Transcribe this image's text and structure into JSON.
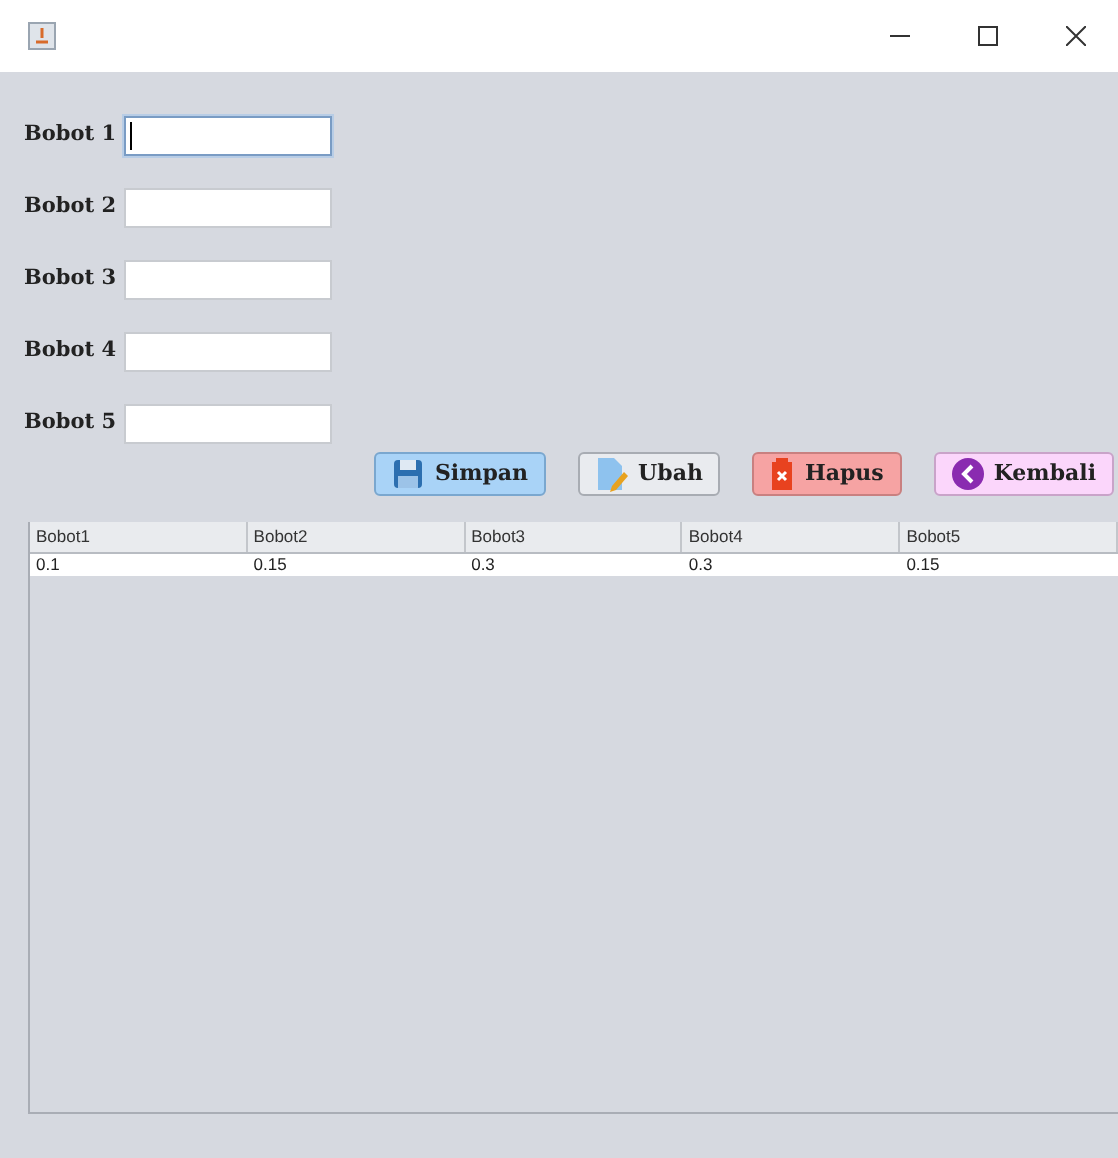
{
  "fields": [
    {
      "label": "Bobot 1",
      "focused": true
    },
    {
      "label": "Bobot 2",
      "focused": false
    },
    {
      "label": "Bobot 3",
      "focused": false
    },
    {
      "label": "Bobot 4",
      "focused": false
    },
    {
      "label": "Bobot 5",
      "focused": false
    }
  ],
  "buttons": [
    {
      "label": "Simpan",
      "kind": "save"
    },
    {
      "label": "Ubah",
      "kind": "edit"
    },
    {
      "label": "Hapus",
      "kind": "delete"
    },
    {
      "label": "Kembali",
      "kind": "back"
    }
  ],
  "table": {
    "columns": [
      "Bobot1",
      "Bobot2",
      "Bobot3",
      "Bobot4",
      "Bobot5"
    ],
    "rows": [
      [
        "0.1",
        "0.15",
        "0.3",
        "0.3",
        "0.15"
      ]
    ]
  }
}
